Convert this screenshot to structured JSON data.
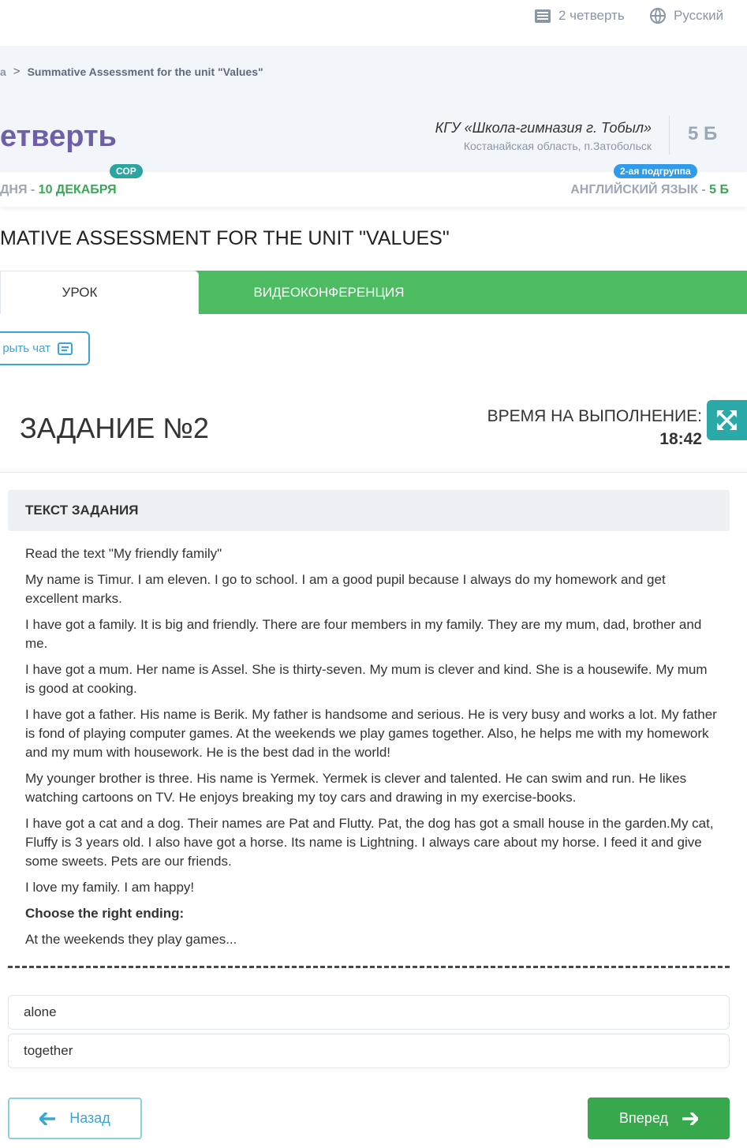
{
  "topbar": {
    "quarter_label": "2 четверть",
    "language_label": "Русский"
  },
  "header": {
    "breadcrumb_prev": "а",
    "breadcrumb_separator": ">",
    "breadcrumb_current": "Summative Assessment for the unit \"Values\"",
    "page_title": "етверть",
    "school_name": "КГУ «Школа-гимназия г. Тобыл»",
    "school_region": "Костанайская область, п.Затобольск",
    "class_label": "5 Б"
  },
  "info": {
    "date_prefix": "ДНЯ - ",
    "date_highlight": "10 ДЕКАБРЯ",
    "sor_badge": "СОР",
    "subject_prefix": "АНГЛИЙСКИЙ ЯЗЫК - ",
    "subject_class": "5 Б",
    "group_badge": "2-ая подгруппа"
  },
  "assessment_title": "MATIVE ASSESSMENT FOR THE UNIT \"VALUES\"",
  "tabs": {
    "lesson": "УРОК",
    "video": "ВИДЕОКОНФЕРЕНЦИЯ"
  },
  "chat_button": "рыть чат",
  "task": {
    "title": "ЗАДАНИЕ №2",
    "time_label": "ВРЕМЯ НА ВЫПОЛНЕНИЕ:",
    "time_value": "18:42",
    "text_heading": "ТЕКСТ ЗАДАНИЯ",
    "paragraphs": [
      "Read the text \"My friendly family\"",
      "My name is Timur. I am eleven. I go to school. I am a good pupil because I always do my homework and get excellent marks.",
      "I have got a family. It is big and friendly. There are four members in my family. They are my mum, dad, brother and me.",
      "I have got a mum. Her name is Assel. She is thirty-seven. My mum is clever and kind. She is a housewife. My mum is good at cooking.",
      "I have got a father. His name is Berik. My father is handsome and serious. He is very busy and works a lot. My father is fond of playing computer games. At the weekends we play games together. Also, he helps me with my homework and my mum with housework. He is the best dad in the world!",
      "My younger brother is three. His name is Yermek. Yermek is clever and talented. He can swim and run. He likes watching cartoons on TV. He enjoys breaking my toy cars and drawing in my exercise-books.",
      "I have got a cat and a dog. Their names are Pat and Flutty. Pat, the dog has got a small house in the garden.My cat, Fluffy is 3 years old. I also have got a horse. Its name is Lightning. I always care about my horse. I feed it and give some sweets. Pets are our friends.",
      "I love my family. I am happy!"
    ],
    "instruction": "Choose the right ending:",
    "question": "At the weekends they play games..."
  },
  "answers": [
    "alone",
    "together"
  ],
  "nav": {
    "back": "Назад",
    "next": "Вперед"
  },
  "icons": {
    "quarter": "list-icon",
    "language": "globe-icon",
    "chat": "chat-icon",
    "expand": "expand-icon",
    "back": "arrow-left-icon",
    "next": "arrow-right-icon"
  },
  "colors": {
    "accent_green": "#4dbb61",
    "button_green": "#38a84c",
    "title_purple": "#6e5fa8",
    "teal": "#2aa9a8",
    "link_blue": "#3aa6d8",
    "group_badge_blue": "#2f9bea"
  }
}
